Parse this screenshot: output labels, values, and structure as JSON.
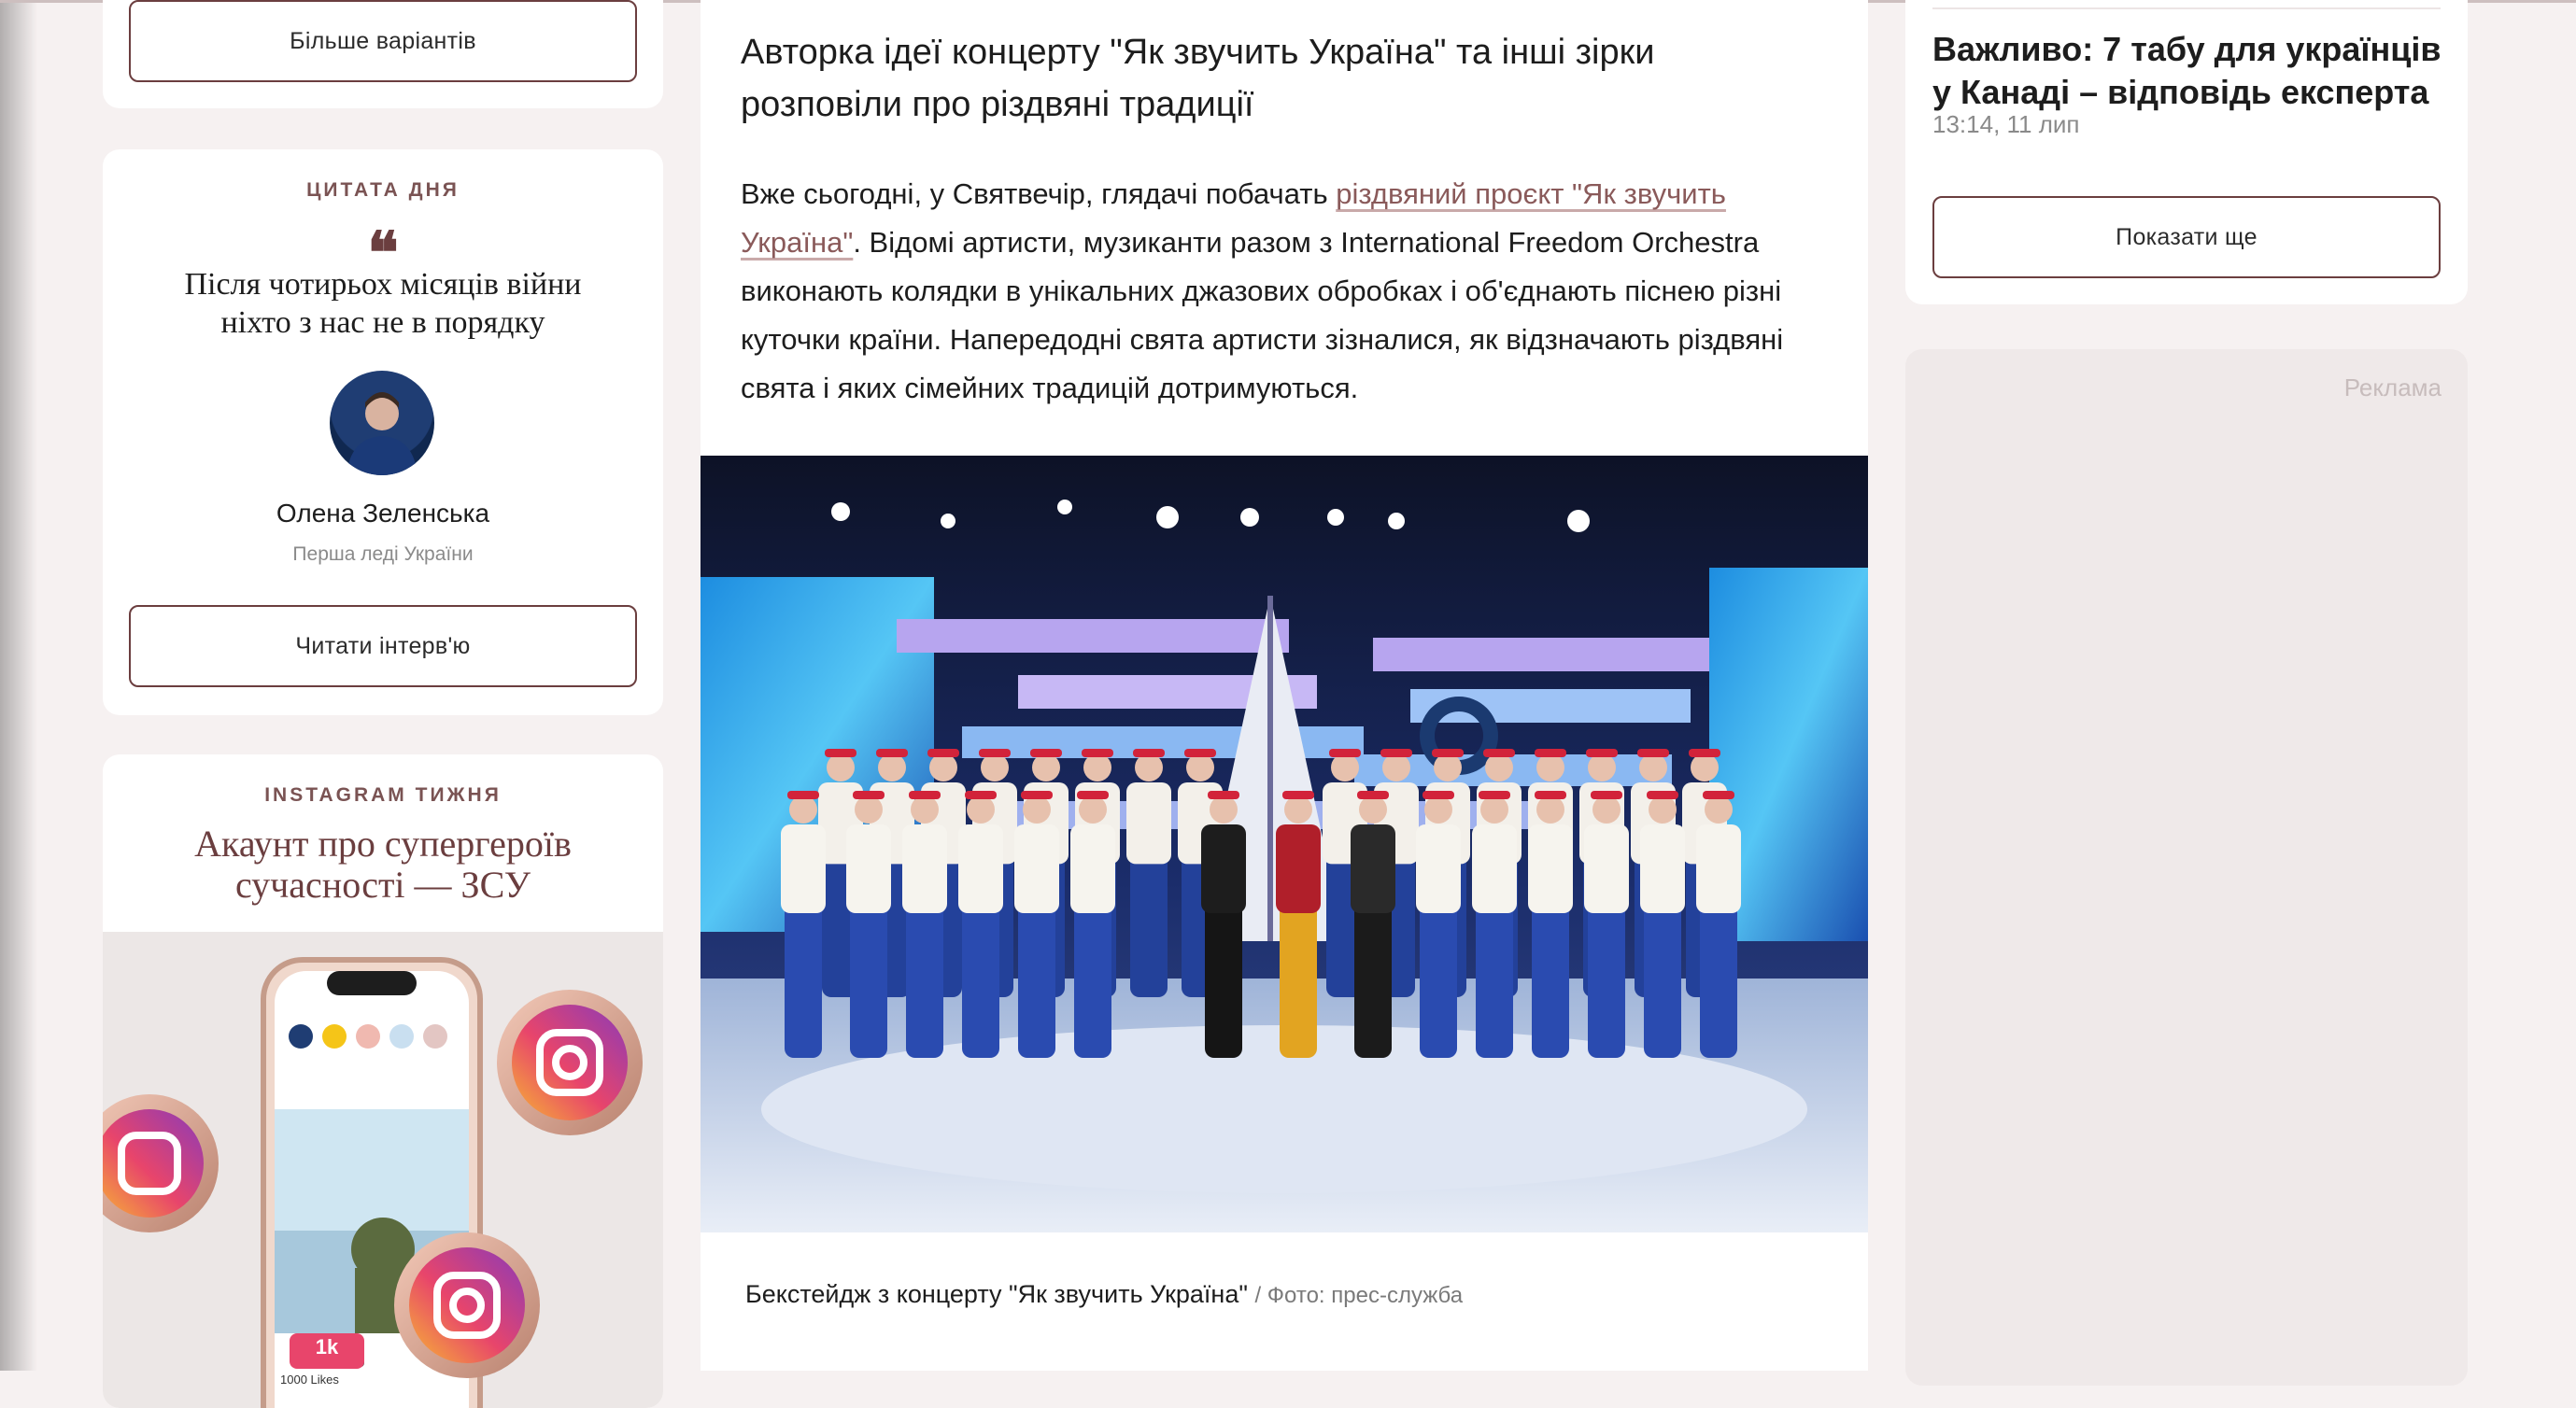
{
  "left": {
    "more_options_label": "Більше варіантів",
    "quote": {
      "overline": "ЦИТАТА ДНЯ",
      "mark": "❝",
      "text": "Після чотирьох місяців війни ніхто з нас не в порядку",
      "author": "Олена Зеленська",
      "author_role": "Перша леді України",
      "button_label": "Читати інтерв'ю"
    },
    "instagram": {
      "overline": "INSTAGRAM ТИЖНЯ",
      "title": "Акаунт про супергероїв сучасності — ЗСУ",
      "likes_badge": "1k",
      "likes_text": "1000 Likes"
    }
  },
  "article": {
    "headline": "Авторка ідеї концерту \"Як звучить Україна\" та інші зірки розповіли про різдвяні традиції",
    "lead_before": "Вже сьогодні, у Святвечір, глядачі побачать ",
    "lead_link": "різдвяний проєкт \"Як звучить Україна\"",
    "lead_after": ". Відомі артисти, музиканти разом з International Freedom Orchestra виконають колядки в унікальних джазових обробках і об'єднають піснею різні куточки країни. Напередодні свята артисти зізналися, як відзначають різдвяні свята і яких сімейних традицій дотримуються.",
    "caption": "Бекстейдж з концерту \"Як звучить Україна\"",
    "caption_credit": "/ Фото: прес-служба"
  },
  "right": {
    "news_title": "Важливо: 7 табу для українців у Канаді – відповідь експерта",
    "news_time": "13:14, 11 лип",
    "show_more_label": "Показати ще",
    "ad_label": "Реклама"
  },
  "colors": {
    "accent": "#6b3e3f",
    "link": "#8a5a5a",
    "page_bg": "#f6f1f1"
  }
}
